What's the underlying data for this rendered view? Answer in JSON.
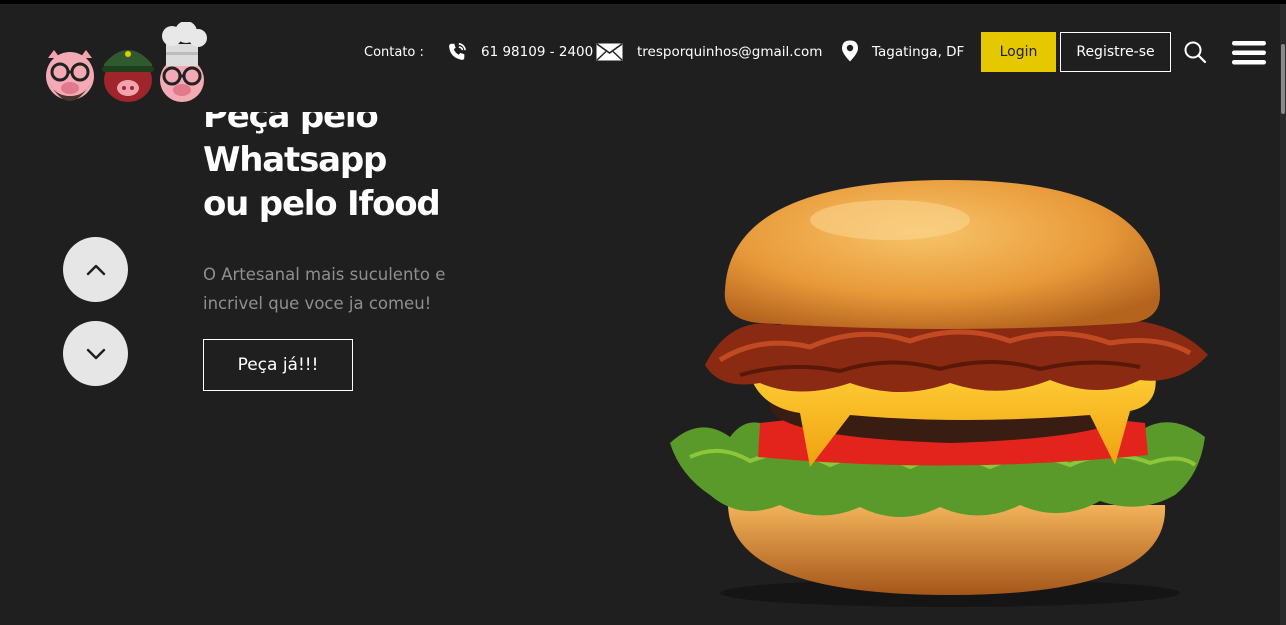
{
  "header": {
    "contact_label": "Contato :",
    "phone": "61 98109 - 2400",
    "email": "tresporquinhos@gmail.com",
    "location": "Tagatinga, DF",
    "login_label": "Login",
    "register_label": "Registre-se"
  },
  "hero": {
    "title_line0": "Peça pelo",
    "title_line1": "Whatsapp",
    "title_line2": "ou pelo Ifood",
    "subtitle": "O Artesanal mais suculento e incrivel que voce ja comeu!",
    "cta_label": "Peça já!!!"
  },
  "colors": {
    "background": "#1f1f1f",
    "accent": "#e6c800",
    "muted_text": "#8f8f8f"
  },
  "icons": [
    "phone-icon",
    "mail-icon",
    "location-pin-icon",
    "search-icon",
    "hamburger-menu-icon",
    "chevron-up-icon",
    "chevron-down-icon"
  ]
}
